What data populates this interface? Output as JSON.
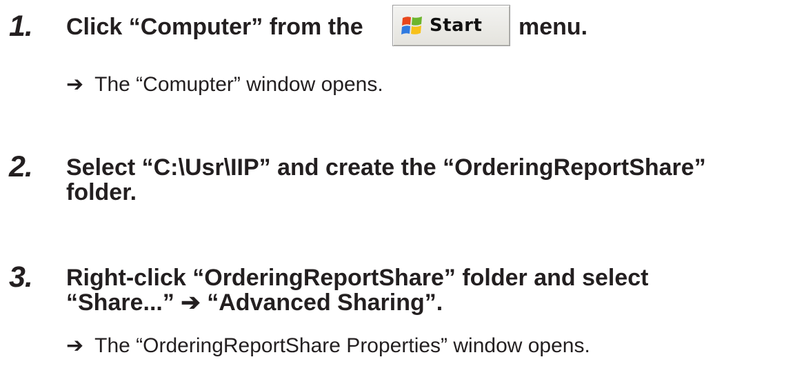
{
  "steps": [
    {
      "number": "1.",
      "text_before": "Click “Computer” from the",
      "text_after": "menu.",
      "result_arrow": "➔",
      "result": "The “Comupter” window opens."
    },
    {
      "number": "2.",
      "line1": "Select “C:\\Usr\\IIP” and create the “OrderingReportShare”",
      "line2": "folder."
    },
    {
      "number": "3.",
      "line1": "Right-click “OrderingReportShare” folder and select",
      "line2": "“Share...” ➔ “Advanced Sharing”.",
      "result_arrow": "➔",
      "result": "The “OrderingReportShare Properties” window opens."
    }
  ],
  "start_button": {
    "label": "Start",
    "icon": "windows-flag-icon"
  }
}
